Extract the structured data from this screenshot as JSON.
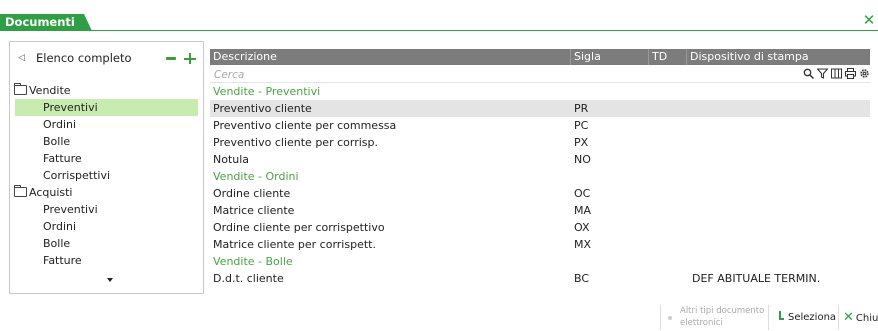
{
  "window": {
    "title": "Documenti"
  },
  "left_panel": {
    "header_title": "Elenco completo",
    "groups": [
      {
        "label": "Vendite",
        "items": [
          "Preventivi",
          "Ordini",
          "Bolle",
          "Fatture",
          "Corrispettivi"
        ],
        "selected_index": 0
      },
      {
        "label": "Acquisti",
        "items": [
          "Preventivi",
          "Ordini",
          "Bolle",
          "Fatture"
        ],
        "selected_index": -1
      }
    ]
  },
  "grid": {
    "columns": [
      "Descrizione",
      "Sigla",
      "TD",
      "Dispositivo di stampa"
    ],
    "search_placeholder": "Cerca",
    "rows": [
      {
        "type": "section",
        "descrizione": "Vendite - Preventivi",
        "sigla": "",
        "td": "",
        "dispositivo": ""
      },
      {
        "type": "row",
        "descrizione": "Preventivo cliente",
        "sigla": "PR",
        "td": "",
        "dispositivo": "",
        "selected": true
      },
      {
        "type": "row",
        "descrizione": "Preventivo cliente per commessa",
        "sigla": "PC",
        "td": "",
        "dispositivo": ""
      },
      {
        "type": "row",
        "descrizione": "Preventivo cliente per corrisp.",
        "sigla": "PX",
        "td": "",
        "dispositivo": ""
      },
      {
        "type": "row",
        "descrizione": "Notula",
        "sigla": "NO",
        "td": "",
        "dispositivo": ""
      },
      {
        "type": "section",
        "descrizione": "Vendite - Ordini",
        "sigla": "",
        "td": "",
        "dispositivo": ""
      },
      {
        "type": "row",
        "descrizione": "Ordine cliente",
        "sigla": "OC",
        "td": "",
        "dispositivo": ""
      },
      {
        "type": "row",
        "descrizione": "Matrice cliente",
        "sigla": "MA",
        "td": "",
        "dispositivo": ""
      },
      {
        "type": "row",
        "descrizione": "Ordine cliente per corrispettivo",
        "sigla": "OX",
        "td": "",
        "dispositivo": ""
      },
      {
        "type": "row",
        "descrizione": "Matrice cliente per corrispett.",
        "sigla": "MX",
        "td": "",
        "dispositivo": ""
      },
      {
        "type": "section",
        "descrizione": "Vendite - Bolle",
        "sigla": "",
        "td": "",
        "dispositivo": ""
      },
      {
        "type": "row",
        "descrizione": "D.d.t. cliente",
        "sigla": "BC",
        "td": "",
        "dispositivo": "DEF ABITUALE TERMIN."
      }
    ]
  },
  "toolbar": {
    "other_types_label": "Altri tipi documento elettronici",
    "select_label": "Seleziona",
    "close_label": "Chiu"
  },
  "icons": [
    "close-icon",
    "back-arrow-icon",
    "collapse-icon",
    "expand-icon",
    "folder-icon",
    "search-icon",
    "filter-icon",
    "columns-icon",
    "print-icon",
    "settings-icon",
    "scroll-down-icon",
    "check-icon"
  ],
  "colors": {
    "accent": "#2f9e44",
    "section_text": "#4aa344",
    "selection_tree": "#c8ecb0",
    "selection_row": "#e4e4e4",
    "header_bg": "#7c7c7c"
  }
}
